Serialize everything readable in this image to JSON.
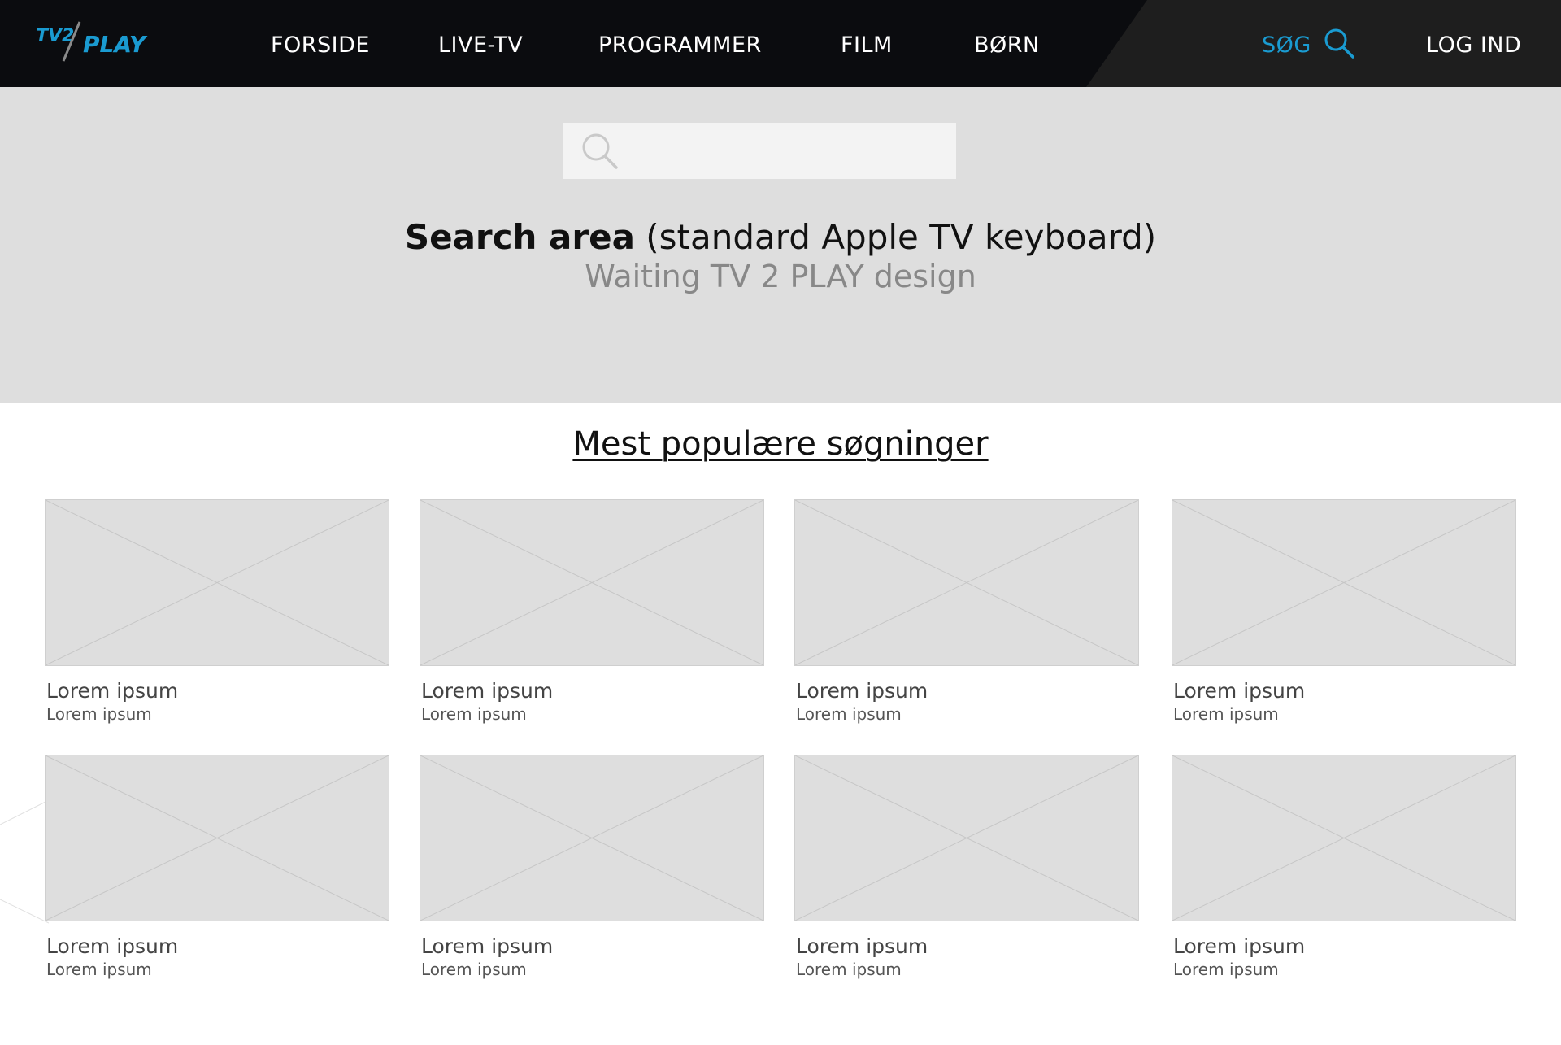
{
  "brand": {
    "logo_text_tv2": "TV2",
    "logo_text_play": "PLAY",
    "accent_color": "#1a9bd1"
  },
  "nav": {
    "items": [
      {
        "label": "FORSIDE"
      },
      {
        "label": "LIVE-TV"
      },
      {
        "label": "PROGRAMMER"
      },
      {
        "label": "FILM"
      },
      {
        "label": "BØRN"
      }
    ],
    "search_label": "SØG",
    "search_icon": "search-icon",
    "login_label": "LOG IND"
  },
  "search": {
    "input_value": "",
    "placeholder": "",
    "heading_bold": "Search area",
    "heading_rest": " (standard Apple TV keyboard)",
    "subheading": "Waiting TV 2 PLAY design"
  },
  "popular": {
    "title": "Mest populære søgninger",
    "cards": [
      {
        "title": "Lorem ipsum",
        "subtitle": "Lorem ipsum"
      },
      {
        "title": "Lorem ipsum",
        "subtitle": "Lorem ipsum"
      },
      {
        "title": "Lorem ipsum",
        "subtitle": "Lorem ipsum"
      },
      {
        "title": "Lorem ipsum",
        "subtitle": "Lorem ipsum"
      },
      {
        "title": "Lorem ipsum",
        "subtitle": "Lorem ipsum"
      },
      {
        "title": "Lorem ipsum",
        "subtitle": "Lorem ipsum"
      },
      {
        "title": "Lorem ipsum",
        "subtitle": "Lorem ipsum"
      },
      {
        "title": "Lorem ipsum",
        "subtitle": "Lorem ipsum"
      }
    ]
  }
}
